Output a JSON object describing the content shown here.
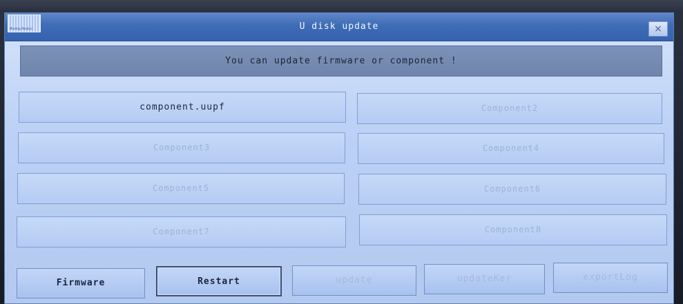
{
  "dialog": {
    "title": "U disk update",
    "close_glyph": "×",
    "logo_text": "Mindray Medical",
    "banner": "You can update firmware or component !"
  },
  "components": [
    {
      "label": "component.uupf",
      "enabled": true
    },
    {
      "label": "Component2",
      "enabled": false
    },
    {
      "label": "Component3",
      "enabled": false
    },
    {
      "label": "Component4",
      "enabled": false
    },
    {
      "label": "Component5",
      "enabled": false
    },
    {
      "label": "Component6",
      "enabled": false
    },
    {
      "label": "Component7",
      "enabled": false
    },
    {
      "label": "Component8",
      "enabled": false
    }
  ],
  "actions": {
    "firmware": "Firmware",
    "restart": "Restart",
    "update": "update",
    "updateker": "updateKer",
    "exportlog": "exportLog"
  },
  "icons": {
    "close": "close-icon",
    "logo": "app-logo-icon"
  }
}
